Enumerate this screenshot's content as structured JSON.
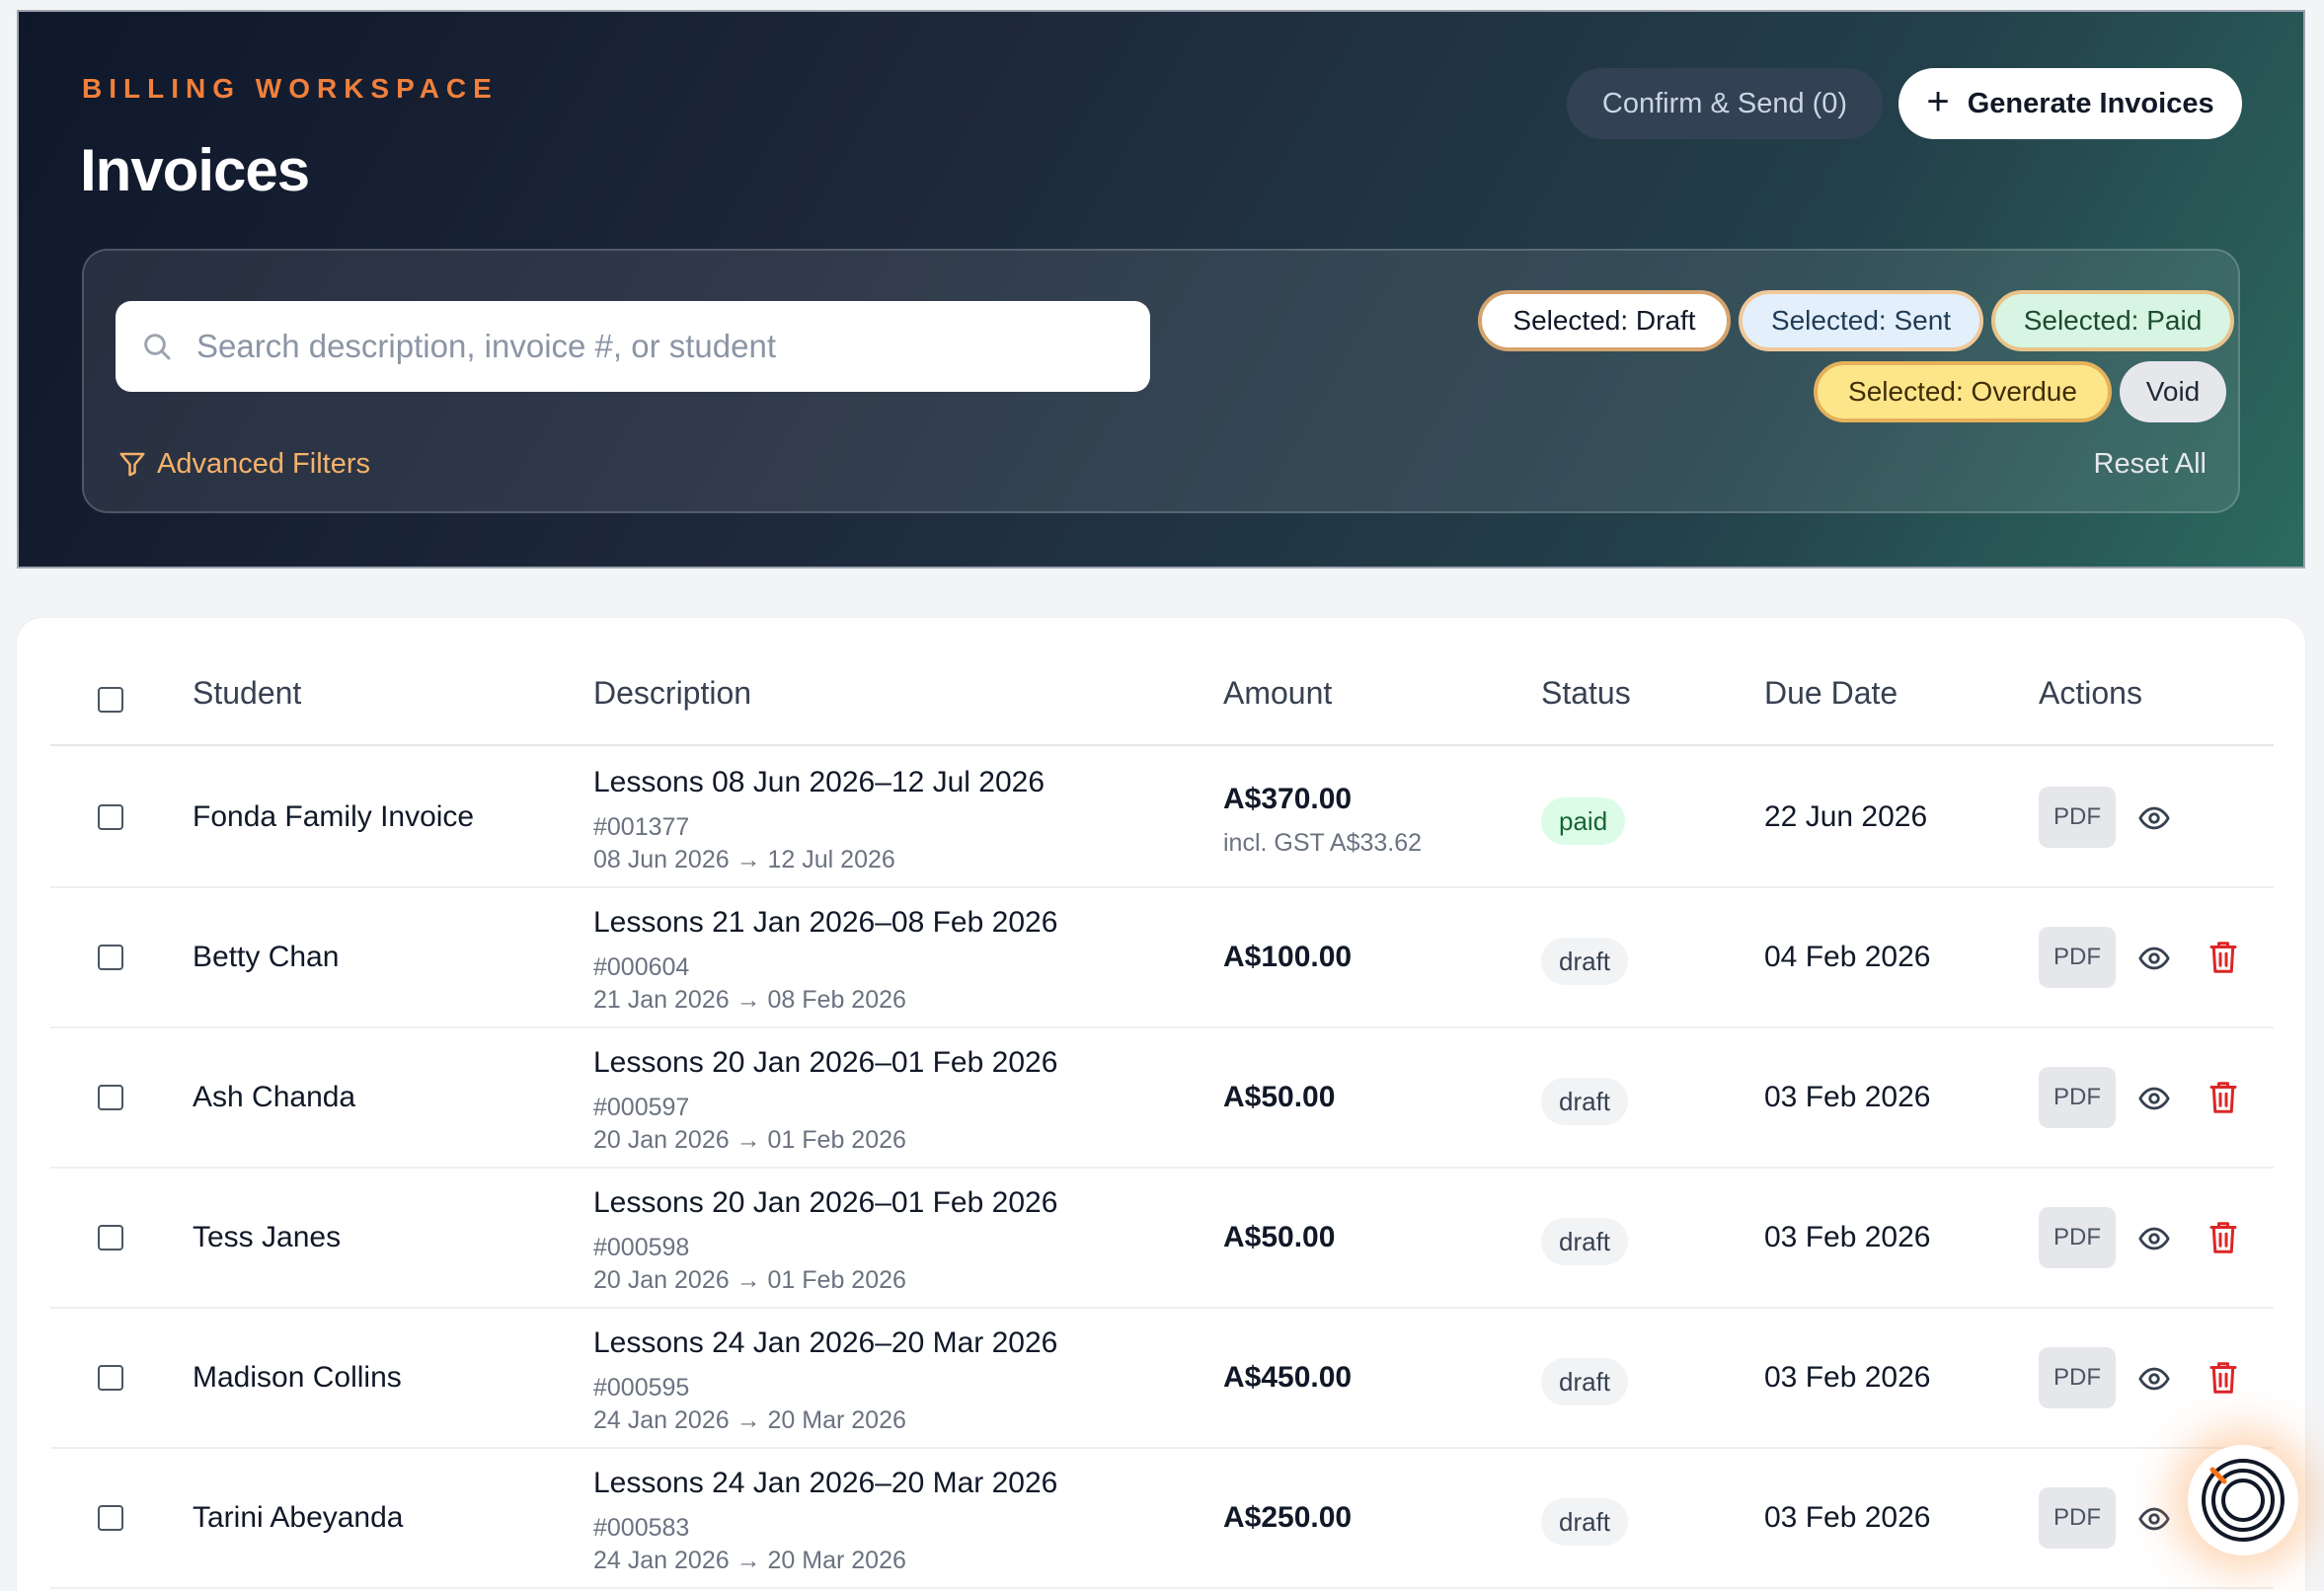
{
  "header": {
    "eyebrow": "BILLING WORKSPACE",
    "title": "Invoices",
    "confirm_send_label": "Confirm & Send (0)",
    "generate_label": "Generate Invoices"
  },
  "filters": {
    "search_placeholder": "Search description, invoice #, or student",
    "search_value": "",
    "chips": {
      "draft": "Selected: Draft",
      "sent": "Selected: Sent",
      "paid": "Selected: Paid",
      "overdue": "Selected: Overdue",
      "void": "Void"
    },
    "advanced_label": "Advanced Filters",
    "reset_label": "Reset All"
  },
  "table": {
    "columns": {
      "student": "Student",
      "description": "Description",
      "amount": "Amount",
      "status": "Status",
      "due_date": "Due Date",
      "actions": "Actions"
    },
    "pdf_label": "PDF",
    "rows": [
      {
        "student": "Fonda Family Invoice",
        "title": "Lessons 08 Jun 2026–12 Jul 2026",
        "number": "#001377",
        "range": "08 Jun 2026 → 12 Jul 2026",
        "amount": "A$370.00",
        "amount_sub": "incl. GST A$33.62",
        "status": "paid",
        "due": "22 Jun 2026",
        "deletable": false
      },
      {
        "student": "Betty Chan",
        "title": "Lessons 21 Jan 2026–08 Feb 2026",
        "number": "#000604",
        "range": "21 Jan 2026 → 08 Feb 2026",
        "amount": "A$100.00",
        "amount_sub": "",
        "status": "draft",
        "due": "04 Feb 2026",
        "deletable": true
      },
      {
        "student": "Ash Chanda",
        "title": "Lessons 20 Jan 2026–01 Feb 2026",
        "number": "#000597",
        "range": "20 Jan 2026 → 01 Feb 2026",
        "amount": "A$50.00",
        "amount_sub": "",
        "status": "draft",
        "due": "03 Feb 2026",
        "deletable": true
      },
      {
        "student": "Tess Janes",
        "title": "Lessons 20 Jan 2026–01 Feb 2026",
        "number": "#000598",
        "range": "20 Jan 2026 → 01 Feb 2026",
        "amount": "A$50.00",
        "amount_sub": "",
        "status": "draft",
        "due": "03 Feb 2026",
        "deletable": true
      },
      {
        "student": "Madison Collins",
        "title": "Lessons 24 Jan 2026–20 Mar 2026",
        "number": "#000595",
        "range": "24 Jan 2026 → 20 Mar 2026",
        "amount": "A$450.00",
        "amount_sub": "",
        "status": "draft",
        "due": "03 Feb 2026",
        "deletable": true
      },
      {
        "student": "Tarini Abeyanda",
        "title": "Lessons 24 Jan 2026–20 Mar 2026",
        "number": "#000583",
        "range": "24 Jan 2026 → 20 Mar 2026",
        "amount": "A$250.00",
        "amount_sub": "",
        "status": "draft",
        "due": "03 Feb 2026",
        "deletable": false
      }
    ]
  },
  "colors": {
    "accent": "#f0803c",
    "danger": "#dc2626"
  }
}
